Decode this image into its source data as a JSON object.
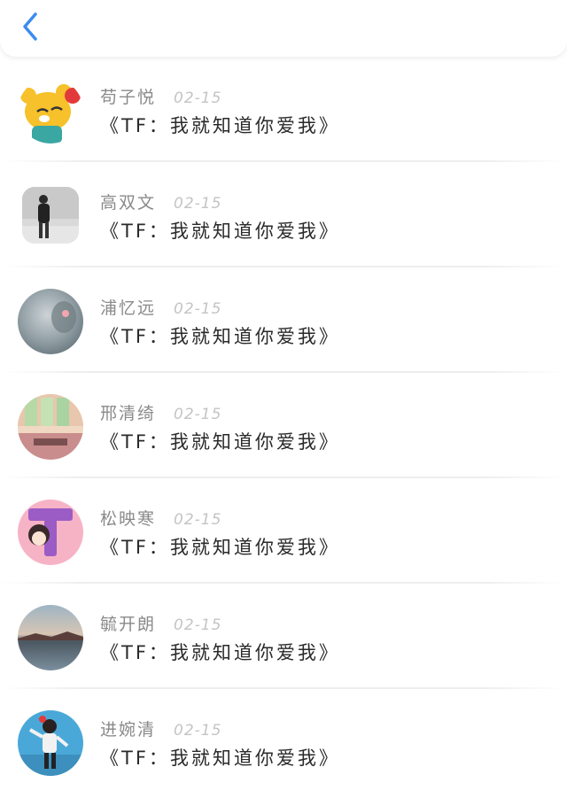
{
  "header": {
    "back_icon": "chevron-left-icon",
    "accent_color": "#3b8cf0"
  },
  "messages": [
    {
      "name": "苟子悦",
      "date": "02-15",
      "text": "《TF：我就知道你爱我》",
      "avatar_icon": "cartoon-fox-avatar"
    },
    {
      "name": "高双文",
      "date": "02-15",
      "text": "《TF：我就知道你爱我》",
      "avatar_icon": "person-photo-avatar"
    },
    {
      "name": "浦忆远",
      "date": "02-15",
      "text": "《TF：我就知道你爱我》",
      "avatar_icon": "blurred-portrait-avatar"
    },
    {
      "name": "邢清绮",
      "date": "02-15",
      "text": "《TF：我就知道你爱我》",
      "avatar_icon": "window-scene-avatar"
    },
    {
      "name": "松映寒",
      "date": "02-15",
      "text": "《TF：我就知道你爱我》",
      "avatar_icon": "letter-t-cartoon-avatar"
    },
    {
      "name": "毓开朗",
      "date": "02-15",
      "text": "《TF：我就知道你爱我》",
      "avatar_icon": "sunset-lake-avatar"
    },
    {
      "name": "进婉清",
      "date": "02-15",
      "text": "《TF：我就知道你爱我》",
      "avatar_icon": "girl-pose-avatar"
    }
  ]
}
